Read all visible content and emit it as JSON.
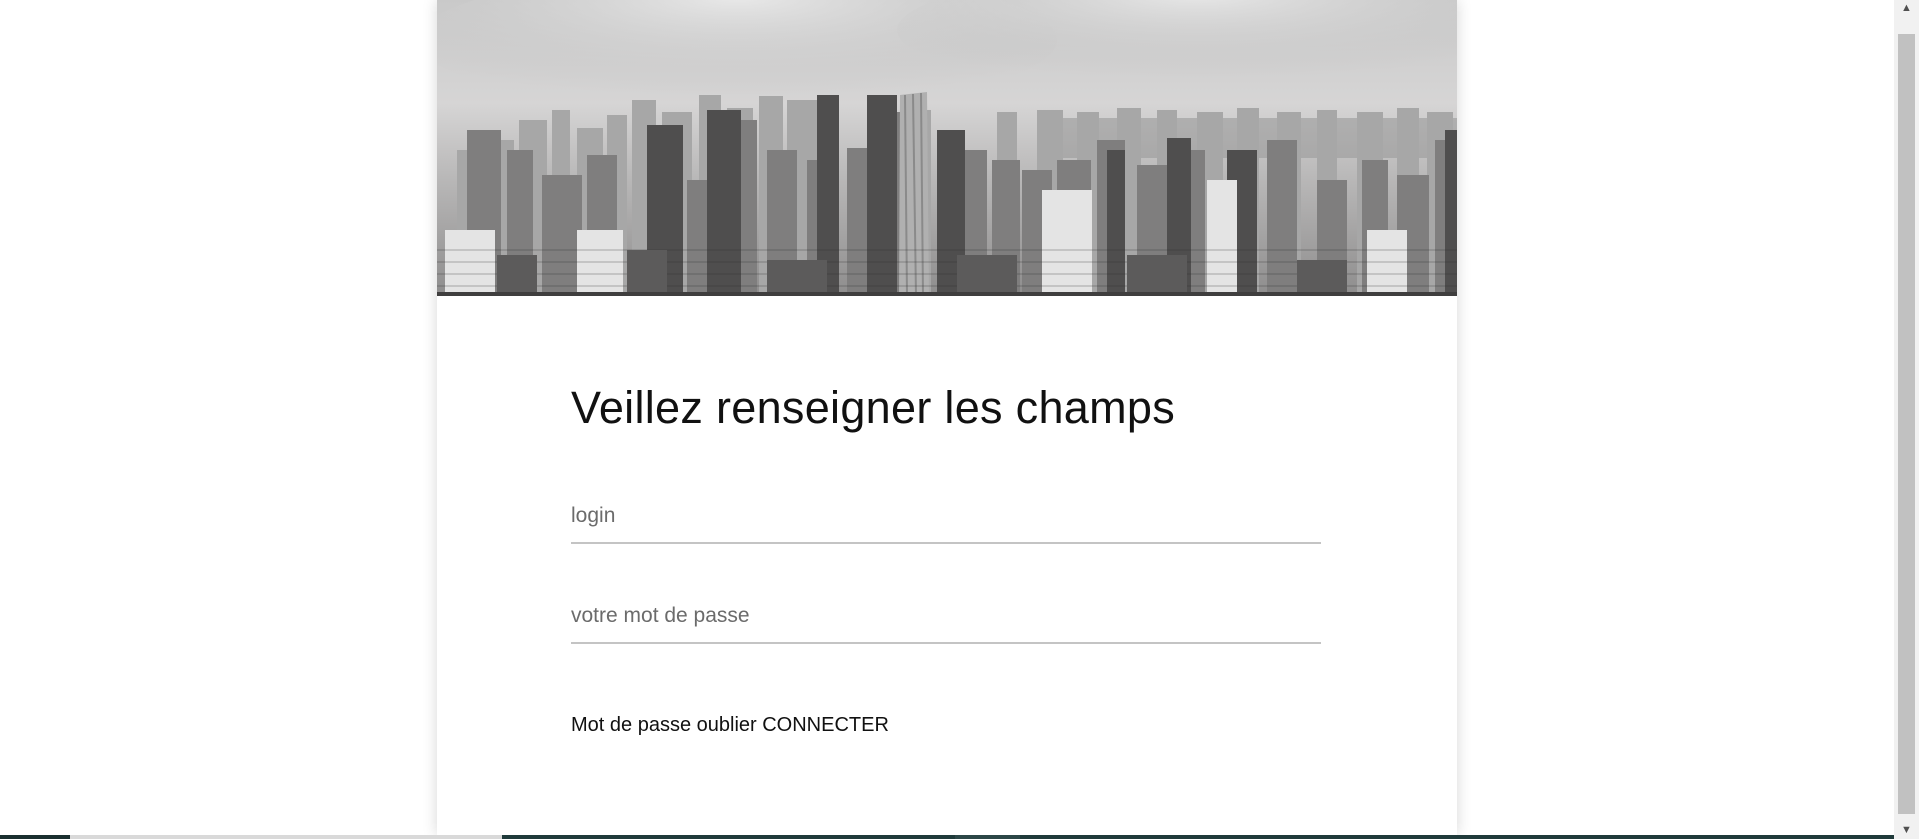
{
  "form": {
    "title": "Veillez renseigner les champs",
    "login_placeholder": "login",
    "password_placeholder": "votre mot de passe",
    "forgot_link": "Mot de passe oublier",
    "connect_link": "CONNECTER"
  },
  "scrollbar": {
    "up_arrow": "▲",
    "down_arrow": "▼"
  },
  "icons": {
    "hero": "city-skyline-image",
    "scroll_up": "triangle-up-icon",
    "scroll_down": "triangle-down-icon"
  },
  "colors": {
    "title_text": "#111111",
    "input_line": "#c4c4c4",
    "placeholder": "#6b6b6b",
    "taskbar": "#1f3a3a"
  }
}
